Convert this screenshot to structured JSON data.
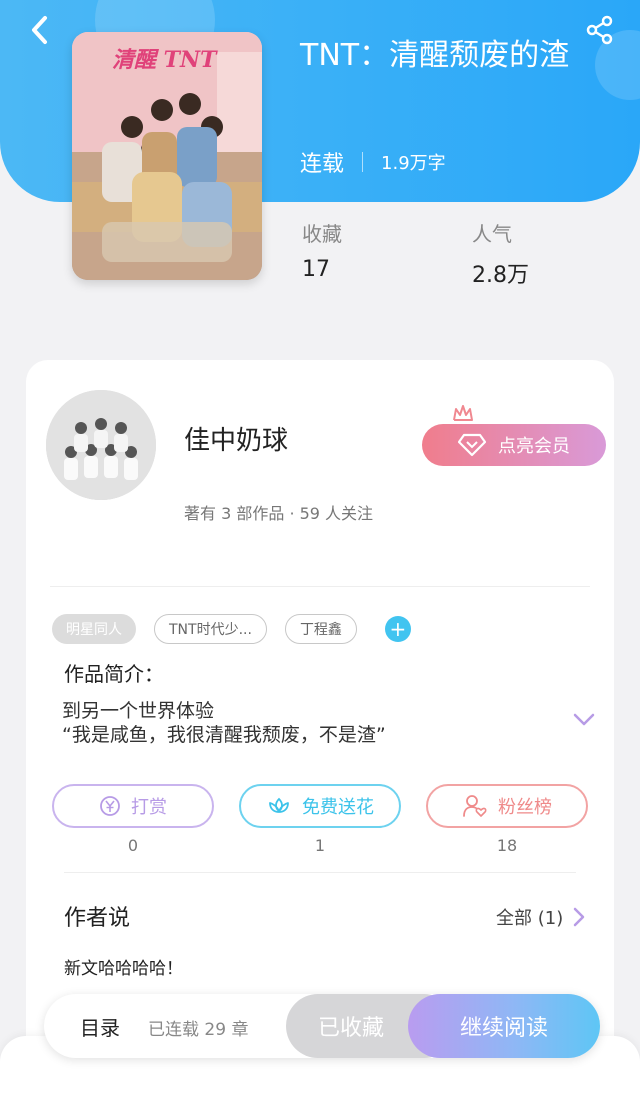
{
  "header": {
    "book_title": "TNT：清醒颓废的渣",
    "status": "连载",
    "word_count": "1.9万字",
    "cover_text": "清醒 TNT",
    "stats": [
      {
        "label": "收藏",
        "value": "17"
      },
      {
        "label": "人气",
        "value": "2.8万"
      }
    ]
  },
  "author": {
    "name": "佳中奶球",
    "summary": "著有 3 部作品 · 59 人关注",
    "vip_label": "点亮会员"
  },
  "tags": [
    {
      "label": "明星同人",
      "style": "filled"
    },
    {
      "label": "TNT时代少...",
      "style": "outline"
    },
    {
      "label": "丁程鑫",
      "style": "outline"
    }
  ],
  "intro": {
    "title": "作品简介：",
    "lines": [
      "到另一个世界体验",
      "“我是咸鱼，我很清醒我颓废，不是渣”"
    ]
  },
  "actions": [
    {
      "label": "打赏",
      "count": "0",
      "color": "#b79be6",
      "icon": "yen-icon"
    },
    {
      "label": "免费送花",
      "count": "1",
      "color": "#3cc3ea",
      "icon": "flower-icon"
    },
    {
      "label": "粉丝榜",
      "count": "18",
      "color": "#ef8a8a",
      "icon": "user-heart-icon"
    }
  ],
  "author_says": {
    "title": "作者说",
    "all_label": "全部 (1)",
    "text": "新文哈哈哈哈！"
  },
  "bottom": {
    "toc_label": "目录",
    "chapters": "已连载 29 章",
    "collected_label": "已收藏",
    "continue_label": "继续阅读"
  },
  "colors": {
    "header_blue": "#3ab0f7",
    "accent_purple": "#b99cf0",
    "vip_pink": "#f07d8c"
  }
}
